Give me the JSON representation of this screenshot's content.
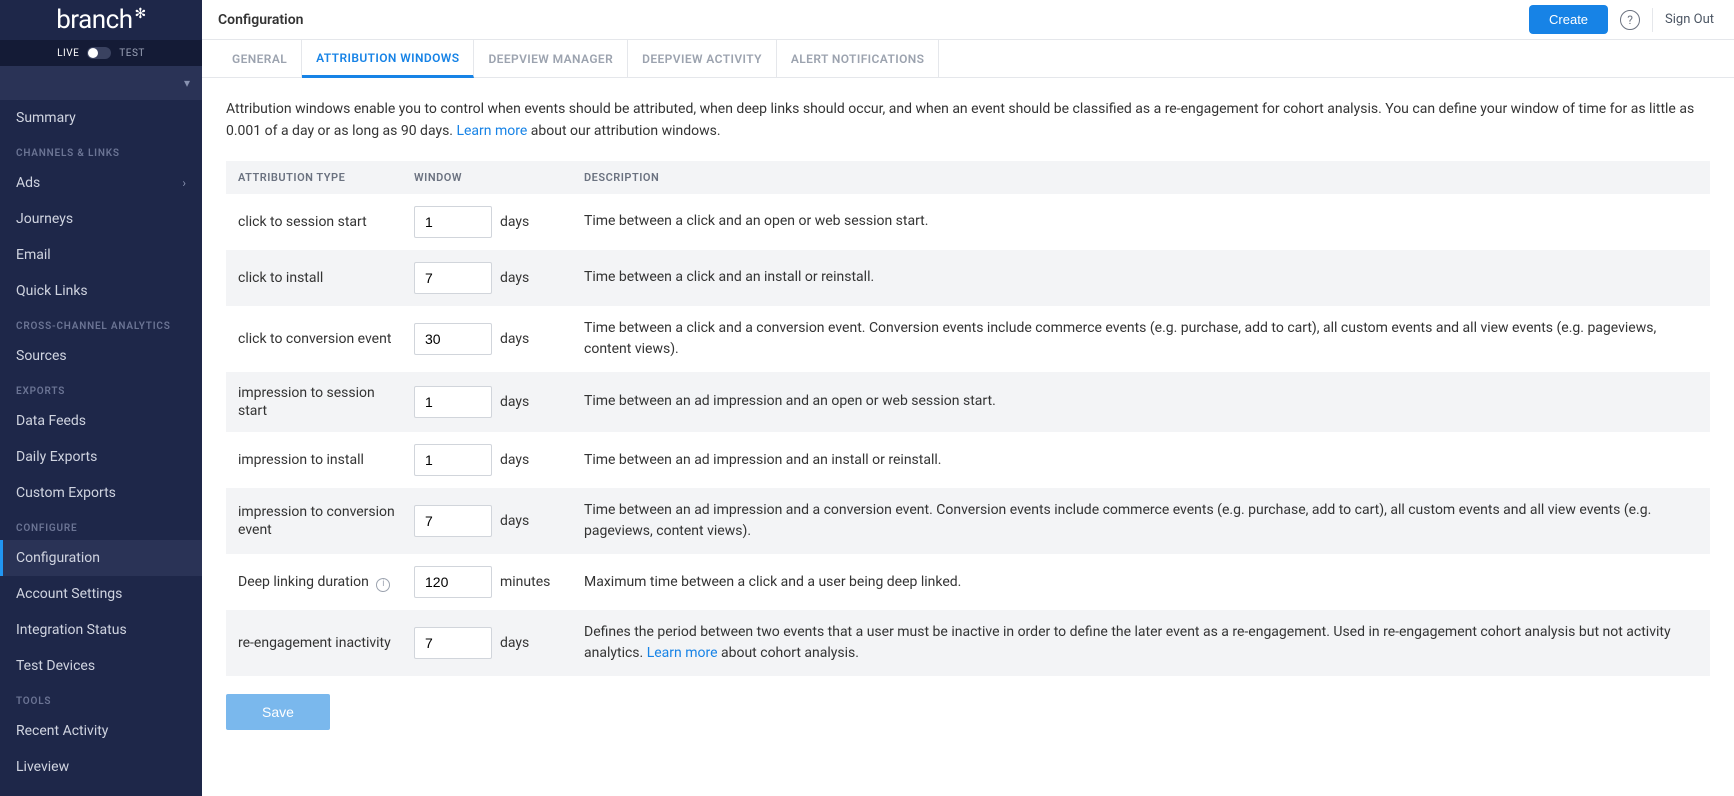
{
  "logo_text": "branch",
  "env": {
    "live": "LIVE",
    "test": "TEST"
  },
  "sidebar": {
    "summary": "Summary",
    "sec_channels": "CHANNELS & LINKS",
    "ads": "Ads",
    "journeys": "Journeys",
    "email": "Email",
    "quick_links": "Quick Links",
    "sec_analytics": "CROSS-CHANNEL ANALYTICS",
    "sources": "Sources",
    "sec_exports": "EXPORTS",
    "data_feeds": "Data Feeds",
    "daily_exports": "Daily Exports",
    "custom_exports": "Custom Exports",
    "sec_configure": "CONFIGURE",
    "configuration": "Configuration",
    "account_settings": "Account Settings",
    "integration_status": "Integration Status",
    "test_devices": "Test Devices",
    "sec_tools": "TOOLS",
    "recent_activity": "Recent Activity",
    "liveview": "Liveview"
  },
  "topbar": {
    "title": "Configuration",
    "create": "Create",
    "signout": "Sign Out"
  },
  "tabs": {
    "general": "GENERAL",
    "attribution": "ATTRIBUTION WINDOWS",
    "deepview_mgr": "DEEPVIEW MANAGER",
    "deepview_act": "DEEPVIEW ACTIVITY",
    "alerts": "ALERT NOTIFICATIONS"
  },
  "intro": {
    "text1": "Attribution windows enable you to control when events should be attributed, when deep links should occur, and when an event should be classified as a re-engagement for cohort analysis. You can define your window of time for as little as 0.001 of a day or as long as 90 days. ",
    "learn_more": "Learn more",
    "text2": " about our attribution windows."
  },
  "headers": {
    "type": "ATTRIBUTION TYPE",
    "window": "WINDOW",
    "desc": "DESCRIPTION"
  },
  "rows": [
    {
      "type": "click to session start",
      "value": "1",
      "unit": "days",
      "desc": "Time between a click and an open or web session start."
    },
    {
      "type": "click to install",
      "value": "7",
      "unit": "days",
      "desc": "Time between a click and an install or reinstall."
    },
    {
      "type": "click to conversion event",
      "value": "30",
      "unit": "days",
      "desc": "Time between a click and a conversion event. Conversion events include commerce events (e.g. purchase, add to cart), all custom events and all view events (e.g. pageviews, content views)."
    },
    {
      "type": "impression to session start",
      "value": "1",
      "unit": "days",
      "desc": "Time between an ad impression and an open or web session start."
    },
    {
      "type": "impression to install",
      "value": "1",
      "unit": "days",
      "desc": "Time between an ad impression and an install or reinstall."
    },
    {
      "type": "impression to conversion event",
      "value": "7",
      "unit": "days",
      "desc": "Time between an ad impression and a conversion event. Conversion events include commerce events (e.g. purchase, add to cart), all custom events and all view events (e.g. pageviews, content views)."
    },
    {
      "type": "Deep linking duration",
      "value": "120",
      "unit": "minutes",
      "desc": "Maximum time between a click and a user being deep linked.",
      "info": true
    },
    {
      "type": "re-engagement inactivity",
      "value": "7",
      "unit": "days",
      "desc_pre": "Defines the period between two events that a user must be inactive in order to define the later event as a re-engagement. Used in re-engagement cohort analysis but not activity analytics. ",
      "learn_more": "Learn more",
      "desc_post": " about cohort analysis."
    }
  ],
  "save": "Save"
}
